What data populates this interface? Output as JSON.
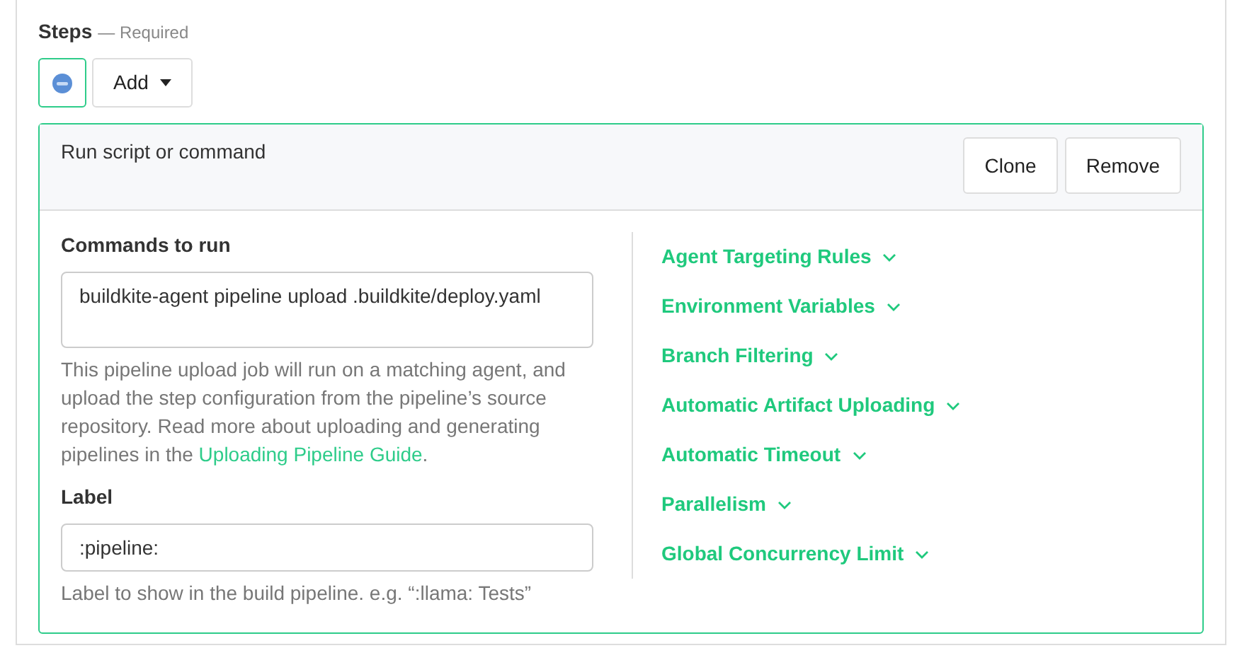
{
  "heading": {
    "title": "Steps",
    "note": "— Required"
  },
  "step_tabs": [
    {
      "selected": true
    }
  ],
  "add_button": {
    "label": "Add"
  },
  "step": {
    "title": "Run script or command",
    "actions": [
      "Clone",
      "Remove"
    ],
    "commands": {
      "label": "Commands to run",
      "value": "buildkite-agent pipeline upload .buildkite/deploy.yaml",
      "help": "This pipeline upload job will run on a matching agent, and upload the step configuration from the pipeline’s source repository. Read more about uploading and generating pipelines in the ",
      "link": "Uploading Pipeline Guide",
      "help_end": "."
    },
    "label_field": {
      "label": "Label",
      "value": ":pipeline:",
      "help": "Label to show in the build pipeline. e.g. “:llama: Tests”"
    },
    "sections": [
      {
        "label": "Agent Targeting Rules",
        "expanded": false
      },
      {
        "label": "Environment Variables",
        "expanded": false
      },
      {
        "label": "Branch Filtering",
        "expanded": false
      },
      {
        "label": "Automatic Artifact Uploading",
        "expanded": false
      },
      {
        "label": "Automatic Timeout",
        "expanded": false
      },
      {
        "label": "Parallelism",
        "expanded": false
      },
      {
        "label": "Global Concurrency Limit",
        "expanded": false
      }
    ]
  }
}
